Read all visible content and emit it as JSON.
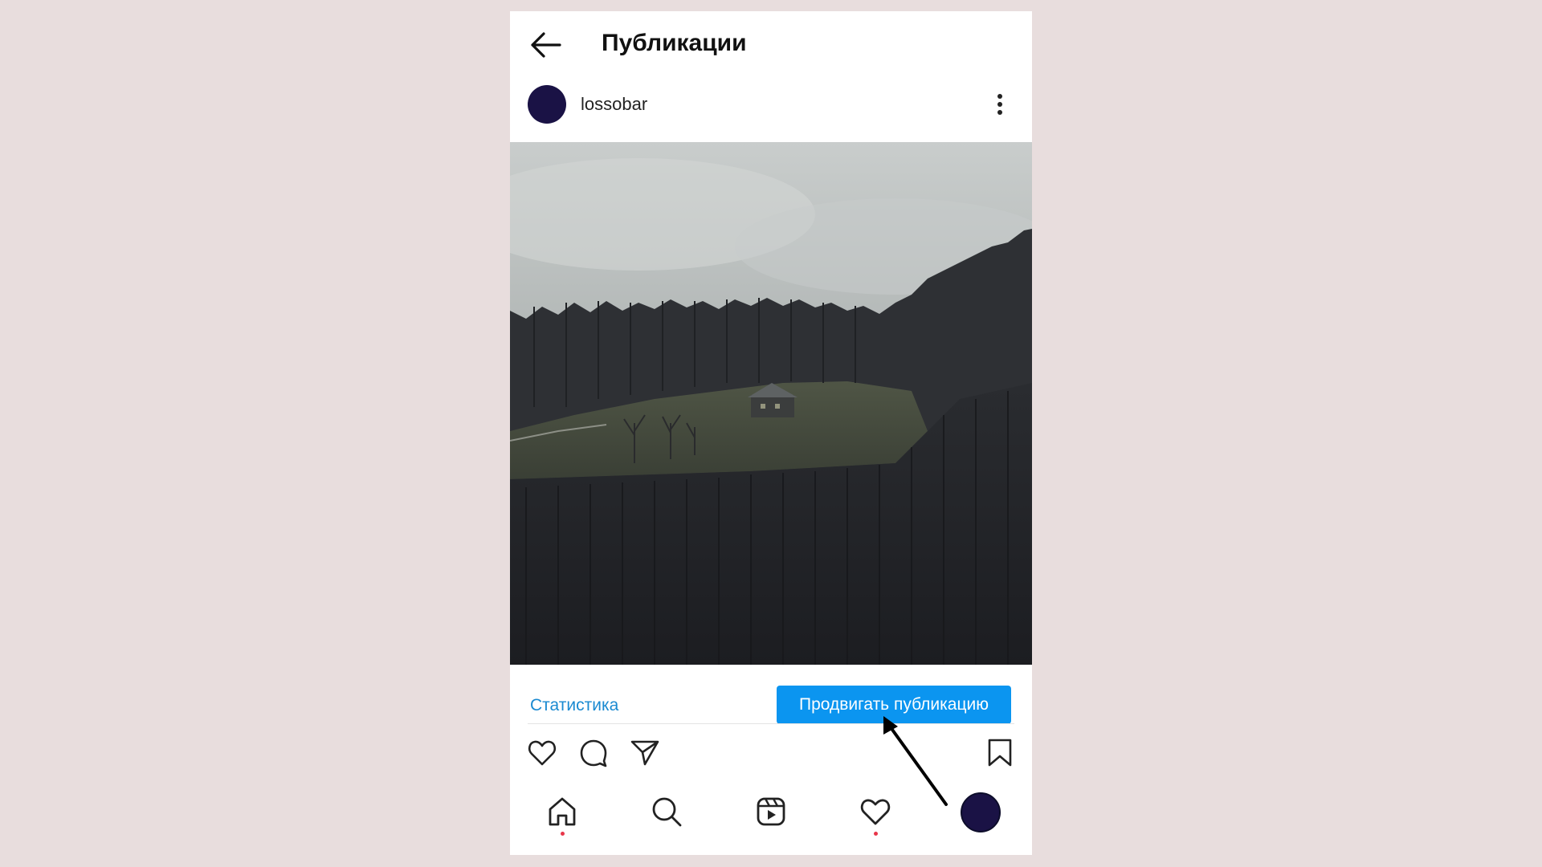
{
  "header": {
    "title": "Публикации",
    "back_icon": "arrow-left-icon"
  },
  "post": {
    "username": "lossobar",
    "avatar_color": "#1a1245",
    "more_icon": "more-vertical-icon",
    "photo_description_icon": "landscape-photo"
  },
  "actions": {
    "stats_label": "Статистика",
    "promote_label": "Продвигать публикацию",
    "promote_color": "#0b95f0",
    "link_color": "#1a8ad1"
  },
  "post_icons": [
    "heart-icon",
    "comment-icon",
    "send-icon",
    "bookmark-icon"
  ],
  "bottom_nav": {
    "items": [
      "home-icon",
      "search-icon",
      "reels-icon",
      "heart-icon",
      "profile-avatar"
    ],
    "notification_dot_color": "#e8364a"
  },
  "colors": {
    "background": "#e8dddd",
    "panel": "#ffffff"
  }
}
